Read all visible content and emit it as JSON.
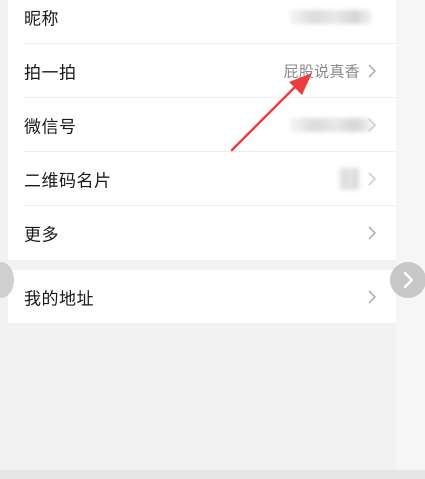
{
  "settings": {
    "rows": [
      {
        "label": "昵称",
        "value": ""
      },
      {
        "label": "拍一拍",
        "value": "屁股说真香"
      },
      {
        "label": "微信号",
        "value": ""
      },
      {
        "label": "二维码名片",
        "value": ""
      },
      {
        "label": "更多",
        "value": ""
      }
    ],
    "address": {
      "label": "我的地址"
    }
  },
  "annotation": {
    "color": "#ee3c3c"
  },
  "colors": {
    "background": "#f2f2f2",
    "card": "#ffffff",
    "text": "#191919",
    "secondary": "#8a8a8a"
  }
}
